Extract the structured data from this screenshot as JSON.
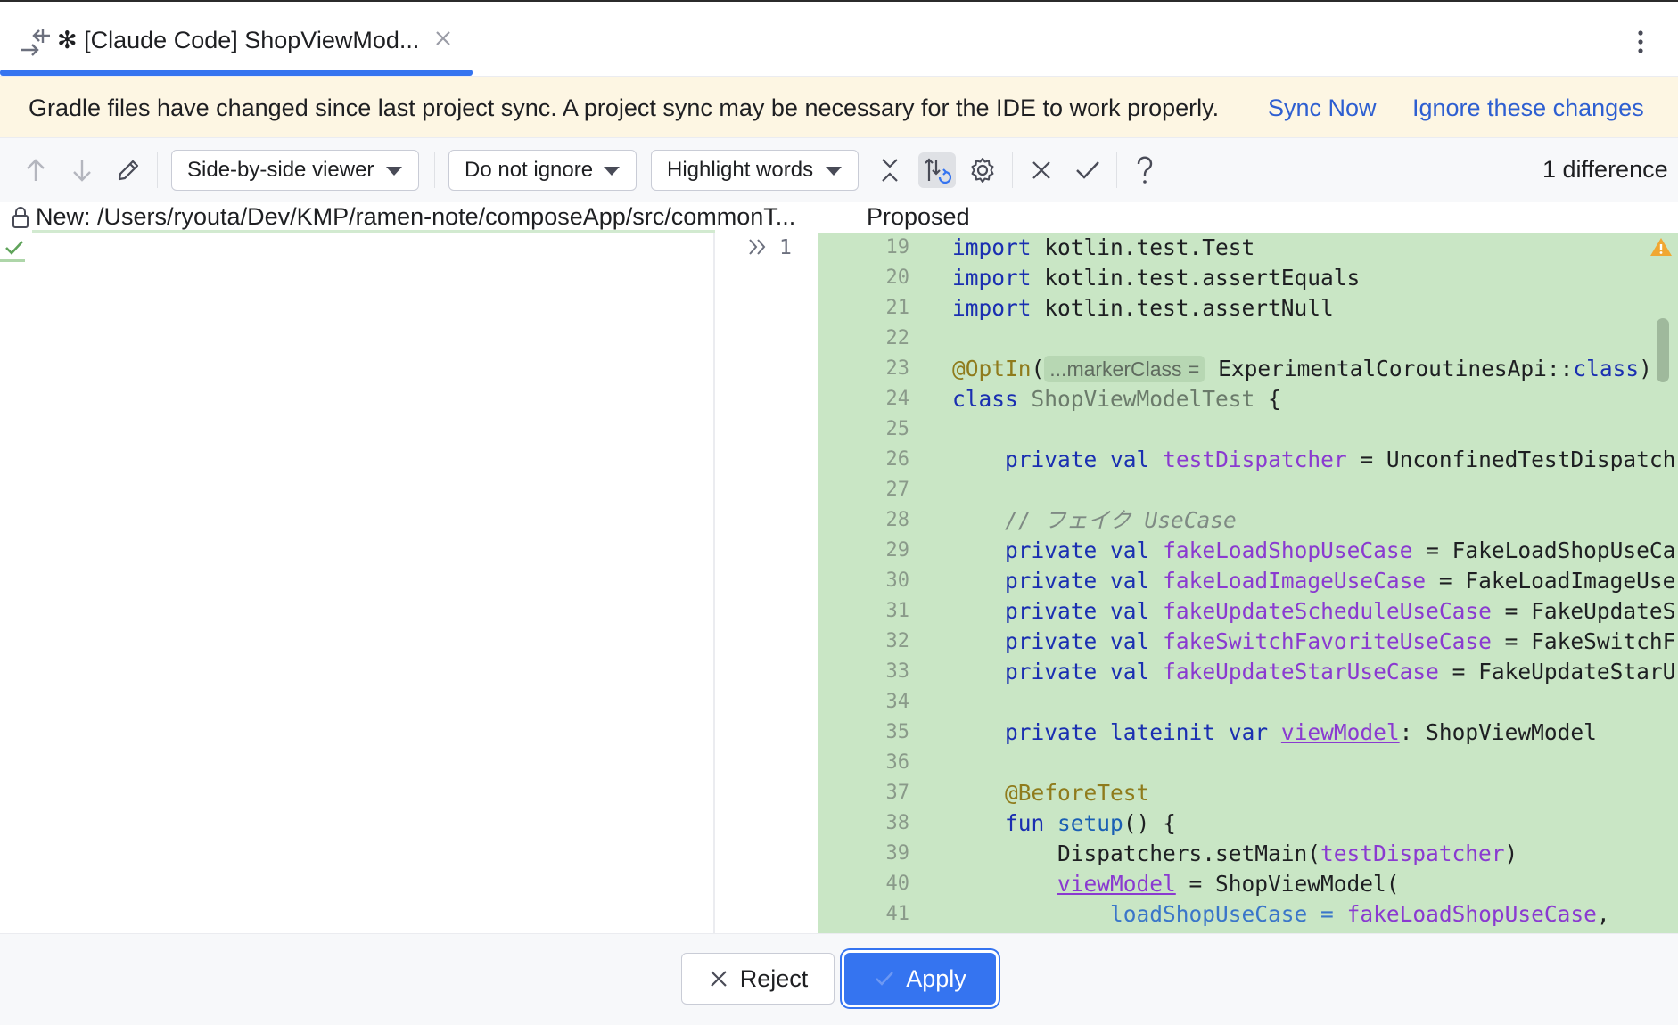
{
  "tab": {
    "title": "✻ [Claude Code] ShopViewMod...",
    "diff_icon": "diff-icon",
    "close_icon": "close-icon"
  },
  "window": {
    "more_icon": "more-vertical-icon"
  },
  "banner": {
    "message": "Gradle files have changed since last project sync. A project sync may be necessary for the IDE to work properly.",
    "sync_link": "Sync Now",
    "ignore_link": "Ignore these changes"
  },
  "toolbar": {
    "viewer_dropdown": "Side-by-side viewer",
    "ignore_dropdown": "Do not ignore",
    "highlight_dropdown": "Highlight words",
    "difference_count": "1 difference",
    "icons": [
      "arrow-up-icon",
      "arrow-down-icon",
      "edit-icon",
      "collapse-icon",
      "sync-scroll-icon",
      "settings-icon",
      "close-icon",
      "check-icon",
      "help-icon"
    ]
  },
  "editor": {
    "left_path": "New: /Users/ryouta/Dev/KMP/ramen-note/composeApp/src/commonT...",
    "right_title": "Proposed",
    "left_gutter_line": "1"
  },
  "code": {
    "lines": [
      {
        "n": "19",
        "t": "import kotlin.test.Test"
      },
      {
        "n": "20",
        "t": "import kotlin.test.assertEquals"
      },
      {
        "n": "21",
        "t": "import kotlin.test.assertNull"
      },
      {
        "n": "22",
        "t": ""
      },
      {
        "n": "23",
        "t": "@OptIn( ...markerClass = ExperimentalCoroutinesApi::class)"
      },
      {
        "n": "24",
        "t": "class ShopViewModelTest {"
      },
      {
        "n": "25",
        "t": ""
      },
      {
        "n": "26",
        "t": "private val testDispatcher = UnconfinedTestDispatch"
      },
      {
        "n": "27",
        "t": ""
      },
      {
        "n": "28",
        "t": "// フェイク UseCase"
      },
      {
        "n": "29",
        "t": "private val fakeLoadShopUseCase = FakeLoadShopUseCa"
      },
      {
        "n": "30",
        "t": "private val fakeLoadImageUseCase = FakeLoadImageUse"
      },
      {
        "n": "31",
        "t": "private val fakeUpdateScheduleUseCase = FakeUpdateS"
      },
      {
        "n": "32",
        "t": "private val fakeSwitchFavoriteUseCase = FakeSwitchF"
      },
      {
        "n": "33",
        "t": "private val fakeUpdateStarUseCase = FakeUpdateStarU"
      },
      {
        "n": "34",
        "t": ""
      },
      {
        "n": "35",
        "t": "private lateinit var viewModel: ShopViewModel"
      },
      {
        "n": "36",
        "t": ""
      },
      {
        "n": "37",
        "t": "@BeforeTest"
      },
      {
        "n": "38",
        "t": "fun setup() {"
      },
      {
        "n": "39",
        "t": "Dispatchers.setMain(testDispatcher)"
      },
      {
        "n": "40",
        "t": "viewModel = ShopViewModel("
      },
      {
        "n": "41",
        "t": "loadShopUseCase = fakeLoadShopUseCase,"
      }
    ]
  },
  "footer": {
    "reject_label": "Reject",
    "apply_label": "Apply"
  },
  "colors": {
    "accent": "#3574f0",
    "added_background": "#c9e6c5",
    "banner_background": "#fdf6e3",
    "link": "#2e5fd1"
  }
}
